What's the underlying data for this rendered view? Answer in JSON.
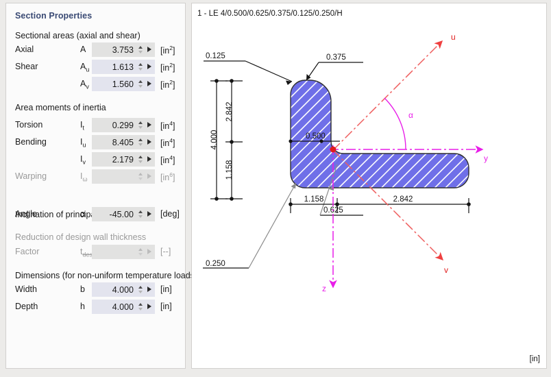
{
  "panel": {
    "title": "Section Properties",
    "groups": [
      {
        "heading": "Sectional areas (axial and shear)",
        "disabled": false
      },
      {
        "heading": "Area moments of inertia",
        "disabled": false
      },
      {
        "heading": "Inclination of principal axes",
        "disabled": false
      },
      {
        "heading": "Reduction of design wall thickness",
        "disabled": true
      },
      {
        "heading": "Dimensions (for non-uniform temperature loads)",
        "disabled": false
      }
    ],
    "rows": [
      {
        "label": "Axial",
        "symbol": "A",
        "sub": "",
        "value": "3.753",
        "unit": "in",
        "exp": "2",
        "style": "grey",
        "disabled": false
      },
      {
        "label": "Shear",
        "symbol": "A",
        "sub": "u",
        "value": "1.613",
        "unit": "in",
        "exp": "2",
        "style": "lav",
        "disabled": false
      },
      {
        "label": "",
        "symbol": "A",
        "sub": "v",
        "value": "1.560",
        "unit": "in",
        "exp": "2",
        "style": "lav",
        "disabled": false
      },
      {
        "label": "Torsion",
        "symbol": "I",
        "sub": "t",
        "value": "0.299",
        "unit": "in",
        "exp": "4",
        "style": "grey",
        "disabled": false
      },
      {
        "label": "Bending",
        "symbol": "I",
        "sub": "u",
        "value": "8.405",
        "unit": "in",
        "exp": "4",
        "style": "grey",
        "disabled": false
      },
      {
        "label": "",
        "symbol": "I",
        "sub": "v",
        "value": "2.179",
        "unit": "in",
        "exp": "4",
        "style": "grey",
        "disabled": false
      },
      {
        "label": "Warping",
        "symbol": "I",
        "sub": "ω",
        "value": "",
        "unit": "in",
        "exp": "6",
        "style": "grey",
        "disabled": true
      },
      {
        "label": "Angle",
        "symbol": "α",
        "sub": "",
        "value": "-45.00",
        "unit": "deg",
        "exp": "",
        "style": "grey",
        "disabled": false
      },
      {
        "label": "Factor",
        "symbol": "t",
        "sub": "des/t",
        "value": "",
        "unit": "--",
        "exp": "",
        "style": "grey",
        "disabled": true
      },
      {
        "label": "Width",
        "symbol": "b",
        "sub": "",
        "value": "4.000",
        "unit": "in",
        "exp": "",
        "style": "lav",
        "disabled": false
      },
      {
        "label": "Depth",
        "symbol": "h",
        "sub": "",
        "value": "4.000",
        "unit": "in",
        "exp": "",
        "style": "lav",
        "disabled": false
      }
    ]
  },
  "drawing": {
    "title": "1 - LE 4/0.500/0.625/0.375/0.125/0.250/H",
    "unit_corner": "[in]",
    "section_fill": "#6f6fe8",
    "hatch_color": "#ffffff",
    "outline_color": "#303030",
    "u_axis_color": "#ef6060",
    "yz_axis_color": "#e81ee8",
    "dimensions": {
      "thickness_top": "0.125",
      "round_top": "0.375",
      "leg_width": "0.500",
      "total_height": "4.000",
      "height_upper": "2.842",
      "height_lower": "1.158",
      "round_bottom": "0.250",
      "centroid_offset": "0.625",
      "width_left": "1.158",
      "width_right": "2.842"
    },
    "axis_labels": {
      "u": "u",
      "v": "v",
      "y": "y",
      "z": "z",
      "alpha": "α"
    }
  }
}
